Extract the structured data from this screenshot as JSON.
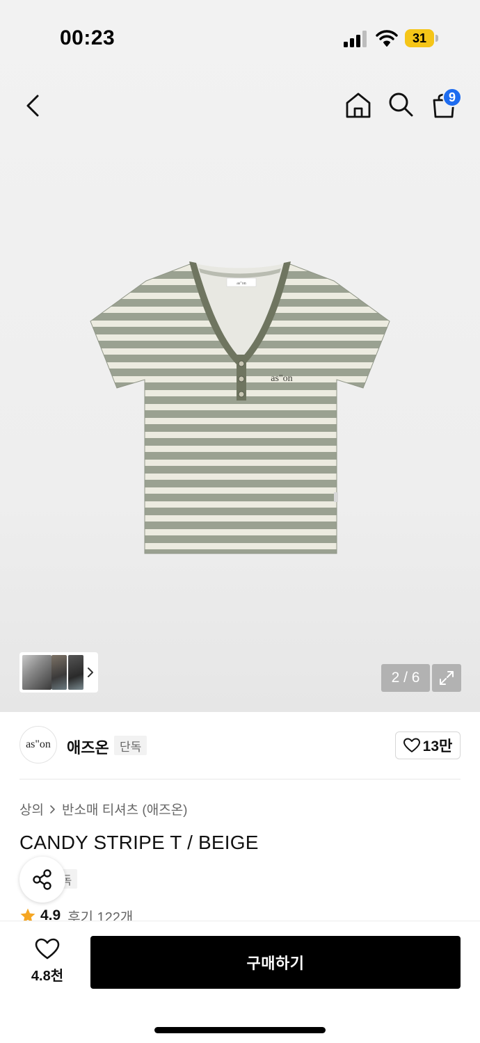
{
  "status_bar": {
    "time": "00:23",
    "battery": "31"
  },
  "header": {
    "cart_count": "9"
  },
  "gallery": {
    "pager": "2 / 6",
    "shirt_logo": "as\"on",
    "tag_text": "as\"on"
  },
  "brand": {
    "logo_text": "as\"on",
    "name": "애즈온",
    "exclusive_label": "단독",
    "likes": "13만"
  },
  "product": {
    "breadcrumb": [
      "상의",
      "반소매 티셔츠 (애즈온)"
    ],
    "title": "CANDY STRIPE T / BEIGE",
    "exclusive_label": "단독",
    "rating": "4.9",
    "reviews": "후기 122개"
  },
  "bottom_bar": {
    "wish_count": "4.8천",
    "buy_label": "구매하기"
  },
  "colors": {
    "accent_badge": "#1e6cf0",
    "battery": "#f5c518",
    "buy_button": "#000000",
    "star": "#f5a623",
    "stripe_green": "#9aa191",
    "stripe_cream": "#ecebe0",
    "trim_olive": "#6f7560"
  },
  "icons": [
    "signal-icon",
    "wifi-icon",
    "back-icon",
    "home-icon",
    "search-icon",
    "cart-icon",
    "chevron-right-icon",
    "expand-icon",
    "heart-icon",
    "share-icon",
    "star-icon"
  ]
}
